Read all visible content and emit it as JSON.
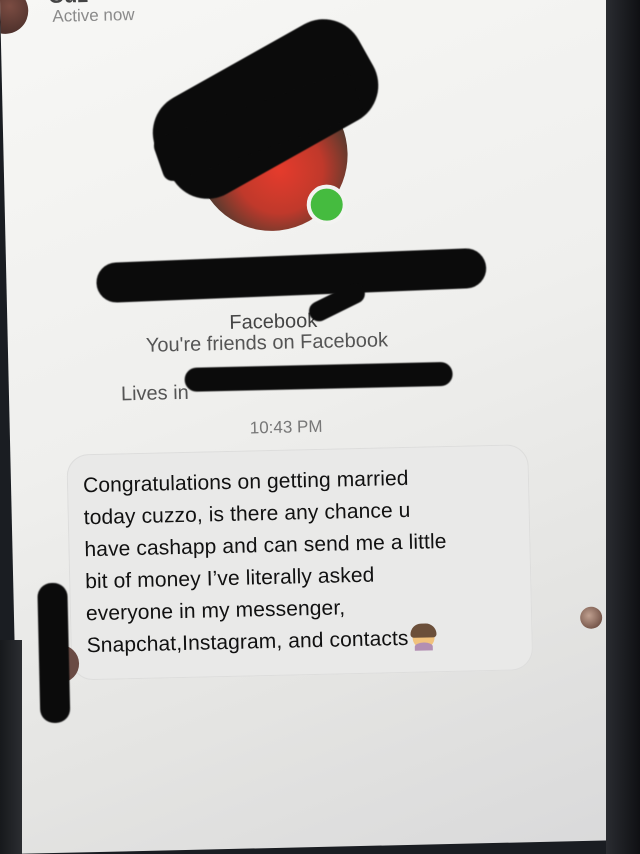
{
  "header": {
    "name": "Cuz",
    "status": "Active now"
  },
  "profile": {
    "name": "",
    "platform": "Facebook",
    "friends_text": "You're friends on Facebook",
    "lives_in": "Lives in"
  },
  "conversation": {
    "timestamp": "10:43 PM",
    "message": "Congratulations on getting married\ntoday cuzzo, is there any chance u\nhave cashapp and can send me a little\nbit of money I’ve literally asked\neveryone in my messenger,\nSnapchat,Instagram, and contacts"
  },
  "icons": {
    "online": "online-status-dot-icon",
    "emoji": "person-shrugging-emoji-icon"
  },
  "colors": {
    "online": "#45bb3f",
    "bubble": "#e9e9e8"
  }
}
